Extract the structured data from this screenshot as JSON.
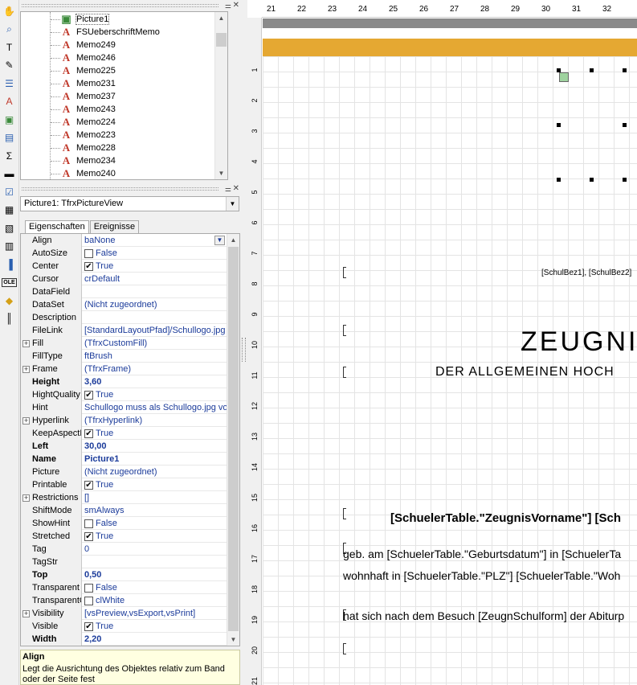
{
  "toolbar": {
    "tools": [
      "hand-icon",
      "zoom-icon",
      "text-cursor-icon",
      "brush-icon",
      "tree-icon",
      "text-object-icon",
      "picture-icon",
      "band-icon",
      "sum-icon",
      "line-icon",
      "checkbox-icon",
      "subreport-icon",
      "richtext-icon",
      "barcode-icon",
      "chart-icon",
      "ole-icon",
      "shape-icon",
      "barcode2-icon"
    ],
    "ole_label": "OLE"
  },
  "tree": {
    "items": [
      {
        "label": "Picture1",
        "type": "picture"
      },
      {
        "label": "FSUeberschriftMemo",
        "type": "memo"
      },
      {
        "label": "Memo249",
        "type": "memo"
      },
      {
        "label": "Memo246",
        "type": "memo"
      },
      {
        "label": "Memo225",
        "type": "memo"
      },
      {
        "label": "Memo231",
        "type": "memo"
      },
      {
        "label": "Memo237",
        "type": "memo"
      },
      {
        "label": "Memo243",
        "type": "memo"
      },
      {
        "label": "Memo224",
        "type": "memo"
      },
      {
        "label": "Memo223",
        "type": "memo"
      },
      {
        "label": "Memo228",
        "type": "memo"
      },
      {
        "label": "Memo234",
        "type": "memo"
      },
      {
        "label": "Memo240",
        "type": "memo"
      }
    ]
  },
  "inspector": {
    "object": "Picture1: TfrxPictureView",
    "tabs": [
      "Eigenschaften",
      "Ereignisse"
    ],
    "rows": [
      {
        "name": "Align",
        "value": "baNone",
        "dropdown": true
      },
      {
        "name": "AutoSize",
        "value": "False",
        "check": false
      },
      {
        "name": "Center",
        "value": "True",
        "check": true
      },
      {
        "name": "Cursor",
        "value": "crDefault"
      },
      {
        "name": "DataField",
        "value": ""
      },
      {
        "name": "DataSet",
        "value": "(Nicht zugeordnet)"
      },
      {
        "name": "Description",
        "value": ""
      },
      {
        "name": "FileLink",
        "value": "[StandardLayoutPfad]/Schullogo.jpg"
      },
      {
        "name": "Fill",
        "value": "(TfrxCustomFill)",
        "expand": true
      },
      {
        "name": "FillType",
        "value": "ftBrush"
      },
      {
        "name": "Frame",
        "value": "(TfrxFrame)",
        "expand": true
      },
      {
        "name": "Height",
        "value": "3,60",
        "bold": true
      },
      {
        "name": "HightQuality",
        "value": "True",
        "check": true
      },
      {
        "name": "Hint",
        "value": "Schullogo muss als Schullogo.jpg vorli"
      },
      {
        "name": "Hyperlink",
        "value": "(TfrxHyperlink)",
        "expand": true
      },
      {
        "name": "KeepAspectRatio",
        "value": "True",
        "check": true
      },
      {
        "name": "Left",
        "value": "30,00",
        "bold": true
      },
      {
        "name": "Name",
        "value": "Picture1",
        "bold": true
      },
      {
        "name": "Picture",
        "value": "(Nicht zugeordnet)"
      },
      {
        "name": "Printable",
        "value": "True",
        "check": true
      },
      {
        "name": "Restrictions",
        "value": "[]",
        "expand": true
      },
      {
        "name": "ShiftMode",
        "value": "smAlways"
      },
      {
        "name": "ShowHint",
        "value": "False",
        "check": false
      },
      {
        "name": "Stretched",
        "value": "True",
        "check": true
      },
      {
        "name": "Tag",
        "value": "0"
      },
      {
        "name": "TagStr",
        "value": ""
      },
      {
        "name": "Top",
        "value": "0,50",
        "bold": true
      },
      {
        "name": "Transparent",
        "value": "False",
        "check": false
      },
      {
        "name": "TransparentColor",
        "value": "clWhite",
        "check": false
      },
      {
        "name": "Visibility",
        "value": "[vsPreview,vsExport,vsPrint]",
        "expand": true
      },
      {
        "name": "Visible",
        "value": "True",
        "check": true
      },
      {
        "name": "Width",
        "value": "2,20",
        "bold": true
      }
    ],
    "help_title": "Align",
    "help_text": "Legt die Ausrichtung des Objektes relativ zum Band oder der Seite fest"
  },
  "design": {
    "hruler": [
      "21",
      "22",
      "23",
      "24",
      "25",
      "26",
      "27",
      "28",
      "29",
      "30",
      "31",
      "32"
    ],
    "vruler": [
      "1",
      "2",
      "3",
      "4",
      "5",
      "6",
      "7",
      "8",
      "9",
      "10",
      "11",
      "12",
      "13",
      "14",
      "15",
      "16",
      "17",
      "18",
      "19",
      "20",
      "21"
    ],
    "schulbez": "[SchulBez1], [SchulBez2]",
    "title": "ZEUGNI",
    "subtitle": "DER ALLGEMEINEN HOCH",
    "student_name": "[SchuelerTable.\"ZeugnisVorname\"] [Sch",
    "birth_line": "geb. am [SchuelerTable.\"Geburtsdatum\"] in [SchuelerTa",
    "address_line": "wohnhaft in [SchuelerTable.\"PLZ\"] [SchuelerTable.\"Woh",
    "school_line": "hat sich nach dem Besuch [ZeugnSchulform] der Abiturp",
    "colors": {
      "orange_band": "#e5a832",
      "gray_band": "#8a8a8a",
      "value_text": "#1b3b9a"
    }
  }
}
